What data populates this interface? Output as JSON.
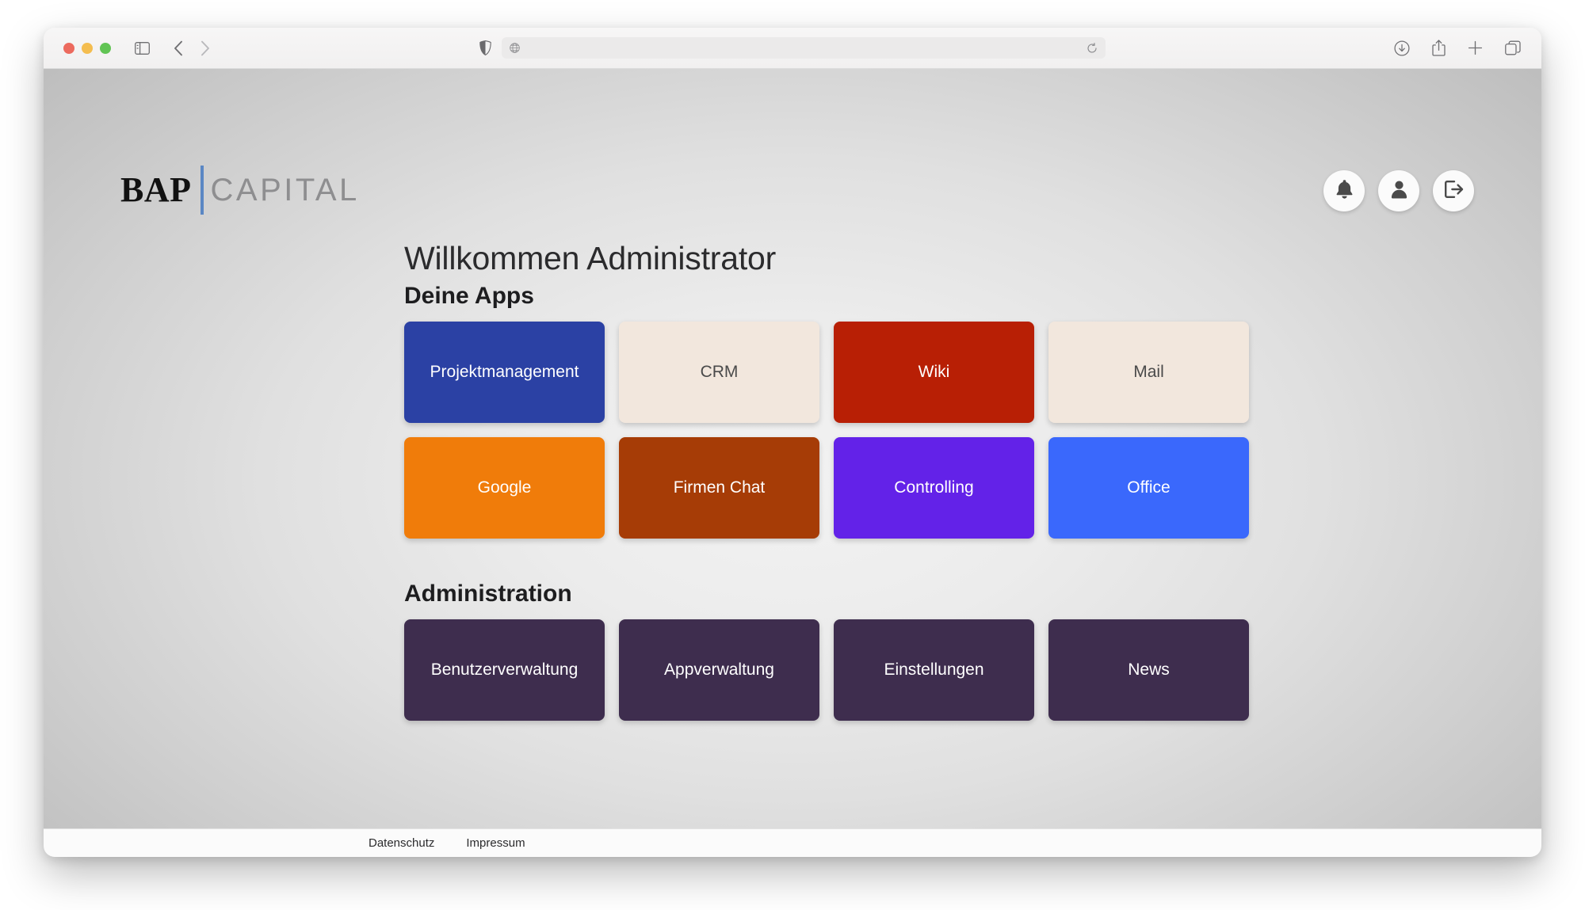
{
  "browser": {
    "traffic_lights": [
      "close",
      "minimize",
      "maximize"
    ],
    "url_value": "",
    "url_placeholder": "",
    "toolbar_icons": {
      "sidebar": "sidebar-toggle-icon",
      "back": "back-arrow-icon",
      "forward": "forward-arrow-icon",
      "shield": "privacy-shield-icon",
      "globe": "globe-icon",
      "reload": "reload-icon",
      "downloads": "downloads-icon",
      "share": "share-icon",
      "new_tab": "plus-icon",
      "tab_overview": "tab-overview-icon"
    }
  },
  "header": {
    "logo": {
      "primary": "BAP",
      "secondary": "CAPITAL",
      "rule_color": "#5b87c4"
    },
    "actions": [
      {
        "name": "notifications-button",
        "icon": "bell-icon"
      },
      {
        "name": "profile-button",
        "icon": "user-icon"
      },
      {
        "name": "logout-button",
        "icon": "logout-icon"
      }
    ]
  },
  "main": {
    "welcome": "Willkommen Administrator",
    "apps_section_title": "Deine Apps",
    "admin_section_title": "Administration",
    "apps": [
      {
        "label": "Projektmanagement",
        "bg": "#2b41a4",
        "fg": "#ffffff"
      },
      {
        "label": "CRM",
        "bg": "#f2e7dd",
        "fg": "#4a4a4a"
      },
      {
        "label": "Wiki",
        "bg": "#b81f05",
        "fg": "#ffffff"
      },
      {
        "label": "Mail",
        "bg": "#f2e7dd",
        "fg": "#4a4a4a"
      },
      {
        "label": "Google",
        "bg": "#f07c0a",
        "fg": "#ffffff"
      },
      {
        "label": "Firmen Chat",
        "bg": "#a63c06",
        "fg": "#ffffff"
      },
      {
        "label": "Controlling",
        "bg": "#6322e8",
        "fg": "#ffffff"
      },
      {
        "label": "Office",
        "bg": "#3a68fc",
        "fg": "#ffffff"
      }
    ],
    "admin_tiles": [
      {
        "label": "Benutzerverwaltung",
        "bg": "#3e2d4e",
        "fg": "#ffffff"
      },
      {
        "label": "Appverwaltung",
        "bg": "#3e2d4e",
        "fg": "#ffffff"
      },
      {
        "label": "Einstellungen",
        "bg": "#3e2d4e",
        "fg": "#ffffff"
      },
      {
        "label": "News",
        "bg": "#3e2d4e",
        "fg": "#ffffff"
      }
    ]
  },
  "footer": {
    "links": [
      {
        "label": "Datenschutz"
      },
      {
        "label": "Impressum"
      }
    ]
  }
}
